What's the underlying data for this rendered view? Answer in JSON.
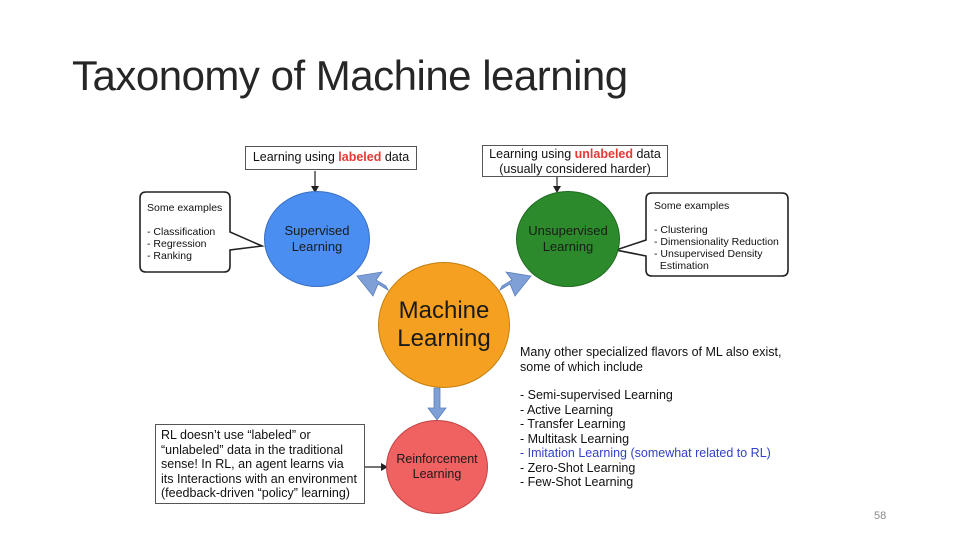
{
  "slide": {
    "title": "Taxonomy of Machine learning",
    "page_number": "58"
  },
  "supervised": {
    "label_prefix": "Learning using ",
    "label_highlight": "labeled",
    "label_suffix": " data",
    "circle_line1": "Supervised",
    "circle_line2": "Learning",
    "examples_text": "Some examples\n\n- Classification\n- Regression\n- Ranking"
  },
  "unsupervised": {
    "label_prefix": "Learning using ",
    "label_highlight": "unlabeled",
    "label_suffix": " data",
    "label_line2": "(usually considered harder)",
    "circle_line1": "Unsupervised",
    "circle_line2": "Learning",
    "examples_text": "Some examples\n\n- Clustering\n- Dimensionality Reduction\n- Unsupervised Density\n  Estimation"
  },
  "center": {
    "line1": "Machine",
    "line2": "Learning"
  },
  "reinforcement": {
    "circle_line1": "Reinforcement",
    "circle_line2": "Learning",
    "note_lines": [
      "RL doesn’t use “labeled” or",
      "“unlabeled” data in the traditional",
      "sense!  In RL, an agent learns via",
      "its Interactions with an environment",
      "(feedback-driven “policy” learning)"
    ]
  },
  "other_flavors": {
    "intro_line1": "Many other specialized flavors of ML also exist,",
    "intro_line2": "some of which include",
    "items": [
      "- Semi-supervised Learning",
      "- Active Learning",
      "- Transfer Learning",
      "- Multitask Learning",
      "- Imitation Learning (somewhat related to RL)",
      "- Zero-Shot Learning",
      "- Few-Shot Learning"
    ]
  },
  "colors": {
    "supervised": "#4a8ef2",
    "unsupervised": "#2c8a2c",
    "center": "#f5a020",
    "reinforcement": "#f06161",
    "arrow": "#7fa0d6",
    "highlight": "#e53935",
    "imitation": "#3340c8"
  }
}
